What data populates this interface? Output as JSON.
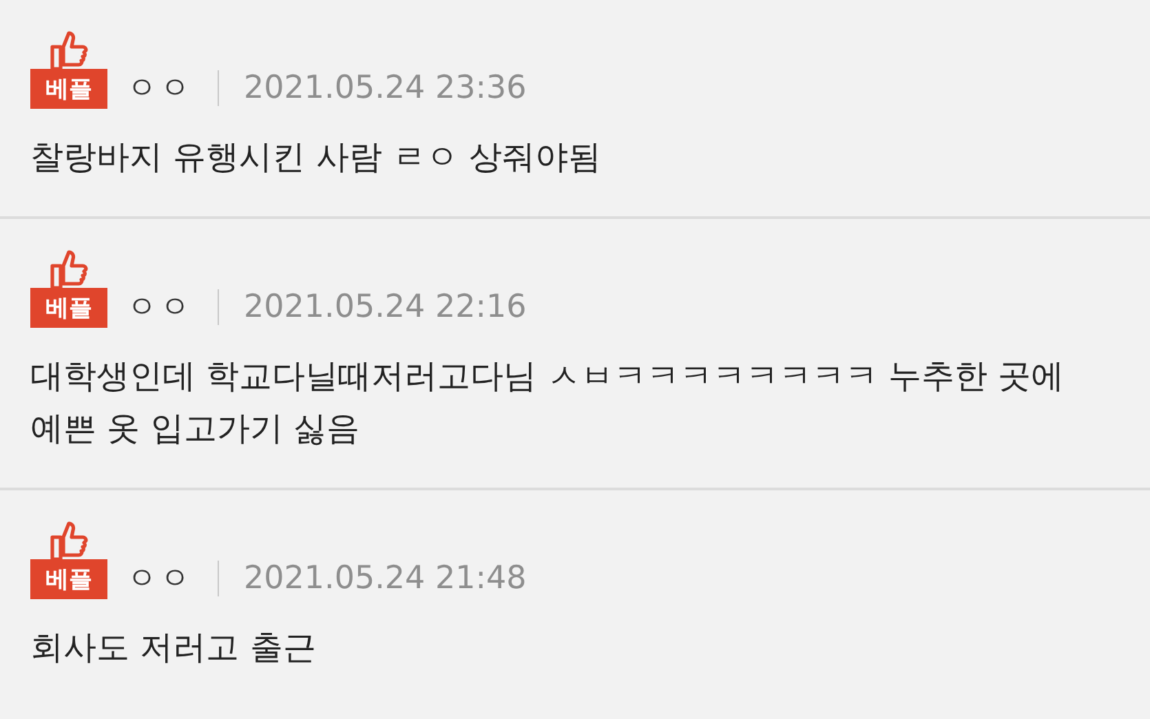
{
  "comments": [
    {
      "badge": "베플",
      "author": "ㅇㅇ",
      "date": "2021.05.24 23:36",
      "text": "찰랑바지 유행시킨 사람 ㄹㅇ 상줘야됨"
    },
    {
      "badge": "베플",
      "author": "ㅇㅇ",
      "date": "2021.05.24 22:16",
      "text": "대학생인데 학교다닐때저러고다님 ㅅㅂㅋㅋㅋㅋㅋㅋㅋㅋ 누추한 곳에 예쁜 옷 입고가기 싫음"
    },
    {
      "badge": "베플",
      "author": "ㅇㅇ",
      "date": "2021.05.24 21:48",
      "text": "회사도 저러고 출근"
    }
  ]
}
